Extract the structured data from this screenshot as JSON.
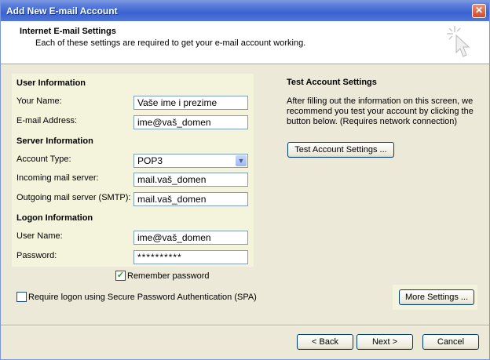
{
  "window": {
    "title": "Add New E-mail Account",
    "close_symbol": "✕"
  },
  "header": {
    "title": "Internet E-mail Settings",
    "subtitle": "Each of these settings are required to get your e-mail account working."
  },
  "user_info": {
    "heading": "User Information",
    "your_name_label": "Your Name:",
    "your_name_value": "Vaše ime i prezime",
    "email_label": "E-mail Address:",
    "email_value": "ime@vaš_domen"
  },
  "server_info": {
    "heading": "Server Information",
    "account_type_label": "Account Type:",
    "account_type_value": "POP3",
    "incoming_label": "Incoming mail server:",
    "incoming_value": "mail.vaš_domen",
    "outgoing_label": "Outgoing mail server (SMTP):",
    "outgoing_value": "mail.vaš_domen"
  },
  "logon_info": {
    "heading": "Logon Information",
    "user_name_label": "User Name:",
    "user_name_value": "ime@vaš_domen",
    "password_label": "Password:",
    "password_value": "**********",
    "remember_password_label": "Remember password",
    "remember_password_checked": true,
    "spa_label": "Require logon using Secure Password Authentication (SPA)",
    "spa_checked": false
  },
  "test_settings": {
    "heading": "Test Account Settings",
    "description": "After filling out the information on this screen, we recommend you test your account by clicking the button below. (Requires network connection)",
    "button_label": "Test Account Settings ..."
  },
  "more_settings_label": "More Settings ...",
  "footer": {
    "back_label": "< Back",
    "next_label": "Next >",
    "cancel_label": "Cancel"
  },
  "colors": {
    "title_bar": "#3a63d1",
    "dialog_bg": "#ece9d8",
    "panel_bg": "#f4f4dc",
    "field_border": "#7f9db9",
    "check_mark": "#21a121"
  }
}
